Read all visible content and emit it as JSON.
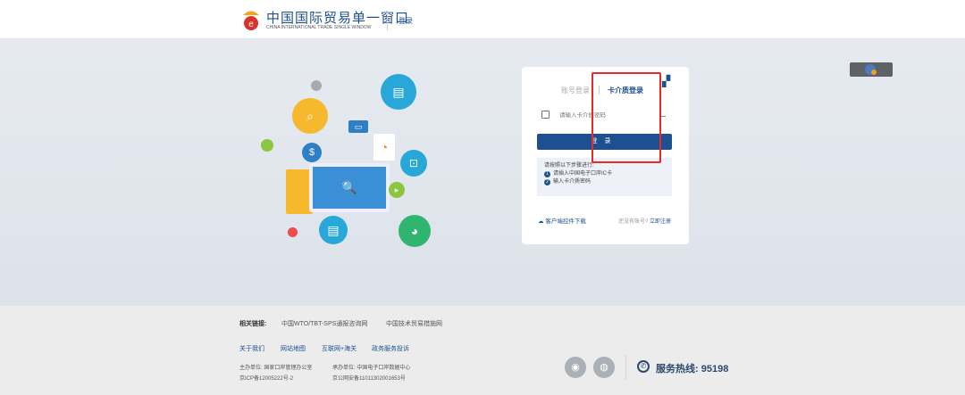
{
  "header": {
    "brand_cn": "中国国际贸易单一窗口",
    "brand_en": "CHINA INTERNATIONAL TRADE SINGLE WINDOW",
    "login_link": "登录"
  },
  "login": {
    "tab_account": "账号登录",
    "tab_card": "卡介质登录",
    "qr_icon": "qr-code",
    "pin_placeholder": "请输入卡介质密码",
    "submit": "登录",
    "tips_title": "请按照以下步骤进行:",
    "steps": [
      {
        "n": "1",
        "text": "请插入中国电子口岸IC卡"
      },
      {
        "n": "2",
        "text": "输入卡介质密码"
      }
    ],
    "download": "客户端控件下载",
    "no_account": "还没有账号?",
    "register": "立即注册"
  },
  "footer": {
    "related_label": "相关链接:",
    "related": [
      "中国WTO/TBT-SPS通报咨询网",
      "中国技术贸易措施网"
    ],
    "links": [
      "关于我们",
      "网站地图",
      "互联网+海关",
      "政务服务投诉"
    ],
    "host": "主办单位: 国家口岸管理办公室",
    "icp": "京ICP备12005222号-2",
    "operator": "承办单位: 中国电子口岸数据中心",
    "police": "京公网安备11011302001653号",
    "hotline": "服务热线: 95198"
  },
  "colors": {
    "brand": "#1d4f91",
    "highlight": "#e62a2a"
  }
}
